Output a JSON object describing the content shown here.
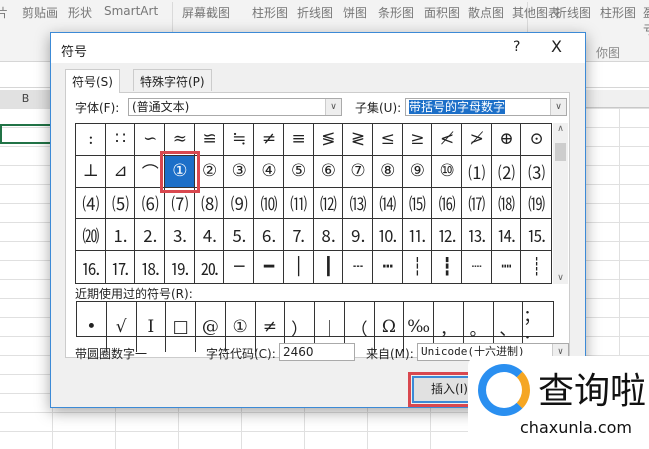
{
  "ribbon": {
    "items": [
      "片",
      "剪贴画",
      "形状",
      "SmartArt",
      "屏幕截图",
      "柱形图",
      "折线图",
      "饼图",
      "条形图",
      "面积图",
      "散点图",
      "其他图表",
      "折线图",
      "柱形图",
      "盈亏"
    ],
    "sub": "你图"
  },
  "sheet": {
    "column": "B"
  },
  "dialog": {
    "title": "符号",
    "help": "?",
    "close": "X",
    "tabs": [
      "符号(S)",
      "特殊字符(P)"
    ],
    "font_label": "字体(F):",
    "font_value": "(普通文本)",
    "subset_label": "子集(U):",
    "subset_value": "带括号的字母数字",
    "symbols": [
      ":",
      "∷",
      "∽",
      "≈",
      "≌",
      "≒",
      "≠",
      "≡",
      "≶",
      "≷",
      "≤",
      "≥",
      "≮",
      "≯",
      "⊕",
      "⊙",
      "⊥",
      "⊿",
      "⌒",
      "①",
      "②",
      "③",
      "④",
      "⑤",
      "⑥",
      "⑦",
      "⑧",
      "⑨",
      "⑩",
      "⑴",
      "⑵",
      "⑶",
      "⑷",
      "⑸",
      "⑹",
      "⑺",
      "⑻",
      "⑼",
      "⑽",
      "⑾",
      "⑿",
      "⒀",
      "⒁",
      "⒂",
      "⒃",
      "⒄",
      "⒅",
      "⒆",
      "⒇",
      "⒈",
      "⒉",
      "⒊",
      "⒋",
      "⒌",
      "⒍",
      "⒎",
      "⒏",
      "⒐",
      "⒑",
      "⒒",
      "⒓",
      "⒔",
      "⒕",
      "⒖",
      "⒗",
      "⒘",
      "⒙",
      "⒚",
      "⒛",
      "─",
      "━",
      "│",
      "┃",
      "┄",
      "┅",
      "┆",
      "┇",
      "┈",
      "┉",
      "┊"
    ],
    "selected_index": 19,
    "recent_label": "近期使用过的符号(R):",
    "recent": [
      "•",
      "√",
      "Ⅰ",
      "□",
      "@",
      "①",
      "≠",
      "）",
      "｜",
      "（",
      "Ω",
      "‰",
      "，",
      "。",
      "、",
      "；",
      "："
    ],
    "char_name": "带圆圈数字一",
    "code_label": "字符代码(C):",
    "code_value": "2460",
    "from_label": "来自(M):",
    "from_value": "Unicode(十六进制)",
    "insert": "插入(I)"
  },
  "watermark": {
    "name": "查询啦",
    "url": "chaxunla.com"
  },
  "colors": {
    "accent": "#1c6fc8",
    "highlight": "#d9484f"
  }
}
